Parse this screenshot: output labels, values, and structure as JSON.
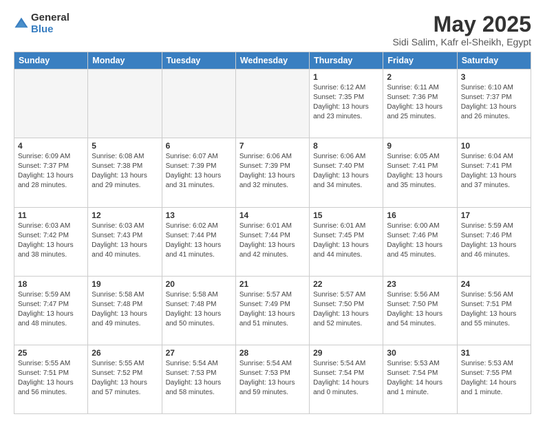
{
  "logo": {
    "general": "General",
    "blue": "Blue"
  },
  "title": "May 2025",
  "subtitle": "Sidi Salim, Kafr el-Sheikh, Egypt",
  "weekdays": [
    "Sunday",
    "Monday",
    "Tuesday",
    "Wednesday",
    "Thursday",
    "Friday",
    "Saturday"
  ],
  "weeks": [
    [
      {
        "day": "",
        "text": ""
      },
      {
        "day": "",
        "text": ""
      },
      {
        "day": "",
        "text": ""
      },
      {
        "day": "",
        "text": ""
      },
      {
        "day": "1",
        "text": "Sunrise: 6:12 AM\nSunset: 7:35 PM\nDaylight: 13 hours\nand 23 minutes."
      },
      {
        "day": "2",
        "text": "Sunrise: 6:11 AM\nSunset: 7:36 PM\nDaylight: 13 hours\nand 25 minutes."
      },
      {
        "day": "3",
        "text": "Sunrise: 6:10 AM\nSunset: 7:37 PM\nDaylight: 13 hours\nand 26 minutes."
      }
    ],
    [
      {
        "day": "4",
        "text": "Sunrise: 6:09 AM\nSunset: 7:37 PM\nDaylight: 13 hours\nand 28 minutes."
      },
      {
        "day": "5",
        "text": "Sunrise: 6:08 AM\nSunset: 7:38 PM\nDaylight: 13 hours\nand 29 minutes."
      },
      {
        "day": "6",
        "text": "Sunrise: 6:07 AM\nSunset: 7:39 PM\nDaylight: 13 hours\nand 31 minutes."
      },
      {
        "day": "7",
        "text": "Sunrise: 6:06 AM\nSunset: 7:39 PM\nDaylight: 13 hours\nand 32 minutes."
      },
      {
        "day": "8",
        "text": "Sunrise: 6:06 AM\nSunset: 7:40 PM\nDaylight: 13 hours\nand 34 minutes."
      },
      {
        "day": "9",
        "text": "Sunrise: 6:05 AM\nSunset: 7:41 PM\nDaylight: 13 hours\nand 35 minutes."
      },
      {
        "day": "10",
        "text": "Sunrise: 6:04 AM\nSunset: 7:41 PM\nDaylight: 13 hours\nand 37 minutes."
      }
    ],
    [
      {
        "day": "11",
        "text": "Sunrise: 6:03 AM\nSunset: 7:42 PM\nDaylight: 13 hours\nand 38 minutes."
      },
      {
        "day": "12",
        "text": "Sunrise: 6:03 AM\nSunset: 7:43 PM\nDaylight: 13 hours\nand 40 minutes."
      },
      {
        "day": "13",
        "text": "Sunrise: 6:02 AM\nSunset: 7:44 PM\nDaylight: 13 hours\nand 41 minutes."
      },
      {
        "day": "14",
        "text": "Sunrise: 6:01 AM\nSunset: 7:44 PM\nDaylight: 13 hours\nand 42 minutes."
      },
      {
        "day": "15",
        "text": "Sunrise: 6:01 AM\nSunset: 7:45 PM\nDaylight: 13 hours\nand 44 minutes."
      },
      {
        "day": "16",
        "text": "Sunrise: 6:00 AM\nSunset: 7:46 PM\nDaylight: 13 hours\nand 45 minutes."
      },
      {
        "day": "17",
        "text": "Sunrise: 5:59 AM\nSunset: 7:46 PM\nDaylight: 13 hours\nand 46 minutes."
      }
    ],
    [
      {
        "day": "18",
        "text": "Sunrise: 5:59 AM\nSunset: 7:47 PM\nDaylight: 13 hours\nand 48 minutes."
      },
      {
        "day": "19",
        "text": "Sunrise: 5:58 AM\nSunset: 7:48 PM\nDaylight: 13 hours\nand 49 minutes."
      },
      {
        "day": "20",
        "text": "Sunrise: 5:58 AM\nSunset: 7:48 PM\nDaylight: 13 hours\nand 50 minutes."
      },
      {
        "day": "21",
        "text": "Sunrise: 5:57 AM\nSunset: 7:49 PM\nDaylight: 13 hours\nand 51 minutes."
      },
      {
        "day": "22",
        "text": "Sunrise: 5:57 AM\nSunset: 7:50 PM\nDaylight: 13 hours\nand 52 minutes."
      },
      {
        "day": "23",
        "text": "Sunrise: 5:56 AM\nSunset: 7:50 PM\nDaylight: 13 hours\nand 54 minutes."
      },
      {
        "day": "24",
        "text": "Sunrise: 5:56 AM\nSunset: 7:51 PM\nDaylight: 13 hours\nand 55 minutes."
      }
    ],
    [
      {
        "day": "25",
        "text": "Sunrise: 5:55 AM\nSunset: 7:51 PM\nDaylight: 13 hours\nand 56 minutes."
      },
      {
        "day": "26",
        "text": "Sunrise: 5:55 AM\nSunset: 7:52 PM\nDaylight: 13 hours\nand 57 minutes."
      },
      {
        "day": "27",
        "text": "Sunrise: 5:54 AM\nSunset: 7:53 PM\nDaylight: 13 hours\nand 58 minutes."
      },
      {
        "day": "28",
        "text": "Sunrise: 5:54 AM\nSunset: 7:53 PM\nDaylight: 13 hours\nand 59 minutes."
      },
      {
        "day": "29",
        "text": "Sunrise: 5:54 AM\nSunset: 7:54 PM\nDaylight: 14 hours\nand 0 minutes."
      },
      {
        "day": "30",
        "text": "Sunrise: 5:53 AM\nSunset: 7:54 PM\nDaylight: 14 hours\nand 1 minute."
      },
      {
        "day": "31",
        "text": "Sunrise: 5:53 AM\nSunset: 7:55 PM\nDaylight: 14 hours\nand 1 minute."
      }
    ]
  ]
}
